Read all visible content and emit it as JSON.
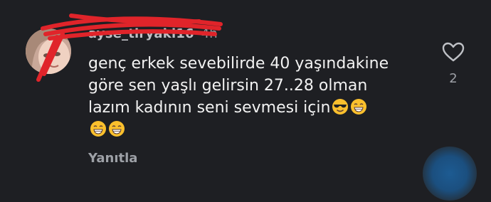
{
  "comment": {
    "username": "ayse_tiryaki16",
    "timestamp": "4h",
    "text_line1": "genç erkek sevebilirde 40 yaşındakine",
    "text_line2": "göre sen yaşlı gelirsin 27..28 olman",
    "text_line3": "lazım kadının seni sevmesi için",
    "reply_label": "Yanıtla",
    "like_count": "2"
  },
  "icons": {
    "heart": "heart-outline-icon",
    "emoji_cool": "smiling-face-with-sunglasses",
    "emoji_grin": "grinning-face-with-smiling-eyes"
  },
  "colors": {
    "background": "#1e1f23",
    "redaction": "#e0242a",
    "fab": "#1d5b92"
  }
}
